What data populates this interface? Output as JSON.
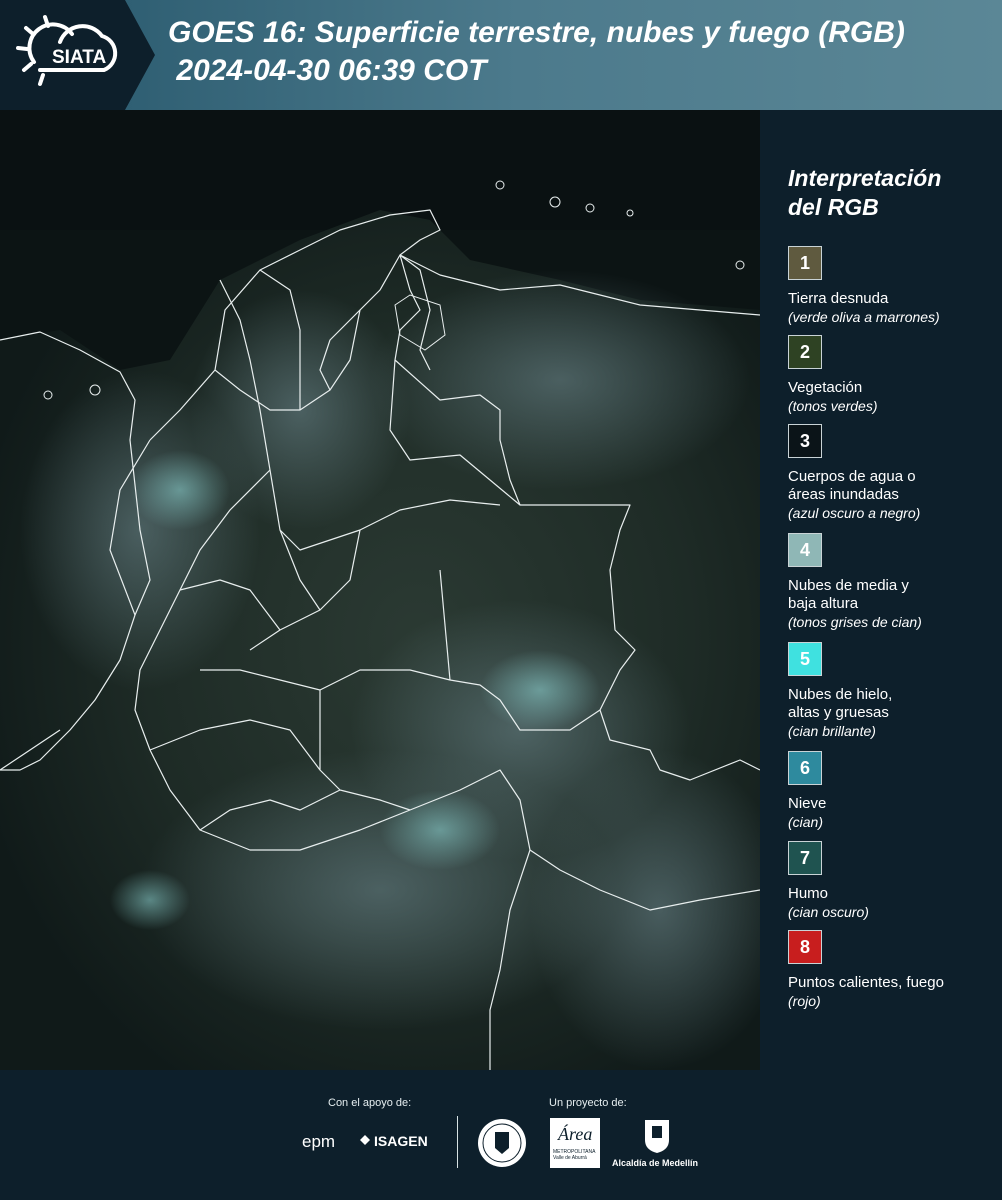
{
  "header": {
    "logo_text": "SIATA",
    "title": "GOES 16: Superficie terrestre, nubes y fuego (RGB)\n 2024-04-30 06:39 COT"
  },
  "map": {
    "description_icon": "satellite-map"
  },
  "legend": {
    "title": "Interpretación\ndel RGB",
    "items": [
      {
        "num": "1",
        "label": "Tierra desnuda",
        "sub": "(verde oliva a marrones)",
        "color": "#5f5a3f"
      },
      {
        "num": "2",
        "label": "Vegetación",
        "sub": "(tonos verdes)",
        "color": "#2e4223"
      },
      {
        "num": "3",
        "label": "Cuerpos de agua o\náreas inundadas",
        "sub": "(azul oscuro a negro)",
        "color": "#0b1418"
      },
      {
        "num": "4",
        "label": "Nubes de media y\nbaja altura",
        "sub": "(tonos grises de cian)",
        "color": "#8fb7b6"
      },
      {
        "num": "5",
        "label": "Nubes de hielo,\naltas y gruesas",
        "sub": "(cian brillante)",
        "color": "#3fe1e0"
      },
      {
        "num": "6",
        "label": "Nieve",
        "sub": "(cian)",
        "color": "#2e8a9e"
      },
      {
        "num": "7",
        "label": "Humo",
        "sub": "(cian oscuro)",
        "color": "#1f5350"
      },
      {
        "num": "8",
        "label": "Puntos calientes, fuego",
        "sub": "(rojo)",
        "color": "#c81e1e"
      }
    ]
  },
  "footer": {
    "support_caption": "Con el apoyo de:",
    "project_caption": "Un proyecto de:",
    "logos": {
      "epm": "epm",
      "isagen": "ISAGEN",
      "area": "Área",
      "area_sub": "METROPOLITANA\nValle de Aburrá",
      "alcaldia": "Alcaldía de Medellín"
    }
  }
}
